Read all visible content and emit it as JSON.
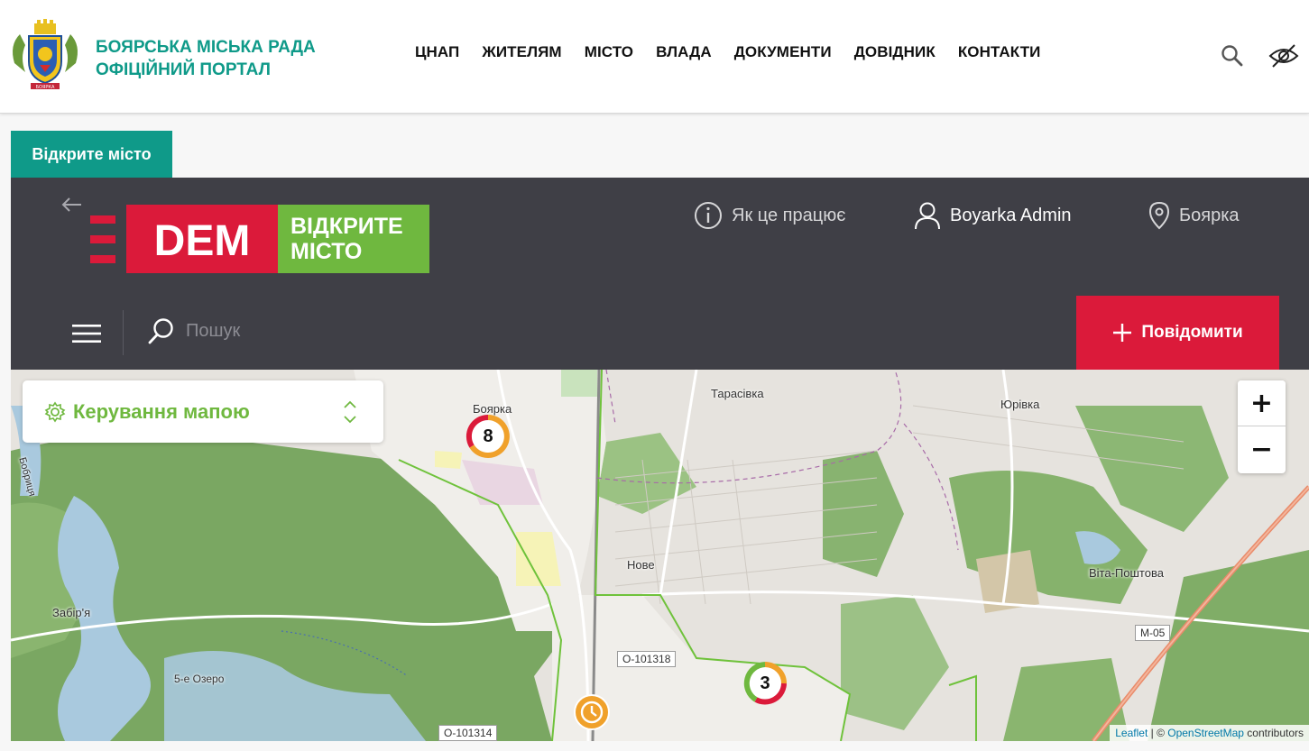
{
  "site": {
    "title_line1": "БОЯРСЬКА МІСЬКА РАДА",
    "title_line2": "ОФІЦІЙНИЙ ПОРТАЛ",
    "coat_text": "БОЯРКА",
    "nav": [
      "ЦНАП",
      "ЖИТЕЛЯМ",
      "МІСТО",
      "ВЛАДА",
      "ДОКУМЕНТИ",
      "ДОВІДНИК",
      "КОНТАКТИ"
    ]
  },
  "tab": {
    "label": "Відкрите місто"
  },
  "widget": {
    "logo_dem": "DEM",
    "logo_line1": "ВІДКРИТЕ",
    "logo_line2": "МІСТО",
    "how_it_works": "Як це працює",
    "user": "Boyarka Admin",
    "city": "Боярка",
    "search_placeholder": "Пошук",
    "report_label": "Повідомити"
  },
  "map": {
    "control_label": "Керування мапою",
    "zoom_in": "+",
    "zoom_out": "−",
    "places": [
      "Боярка",
      "Тарасівка",
      "Юрівка",
      "Нове",
      "Віта-Поштова",
      "Забір'я",
      "5-е Озеро",
      "Бобриця"
    ],
    "roads": [
      "О-101318",
      "М-05",
      "О-101314"
    ],
    "clusters": [
      {
        "count": "8"
      },
      {
        "count": "3"
      }
    ],
    "attribution_leaflet": "Leaflet",
    "attribution_sep": " | © ",
    "attribution_osm": "OpenStreetMap",
    "attribution_tail": " contributors"
  },
  "colors": {
    "brand_teal": "#0f9a89",
    "dark_header": "#3f3f46",
    "accent_red": "#db1a3a",
    "accent_green": "#6fb83f"
  }
}
